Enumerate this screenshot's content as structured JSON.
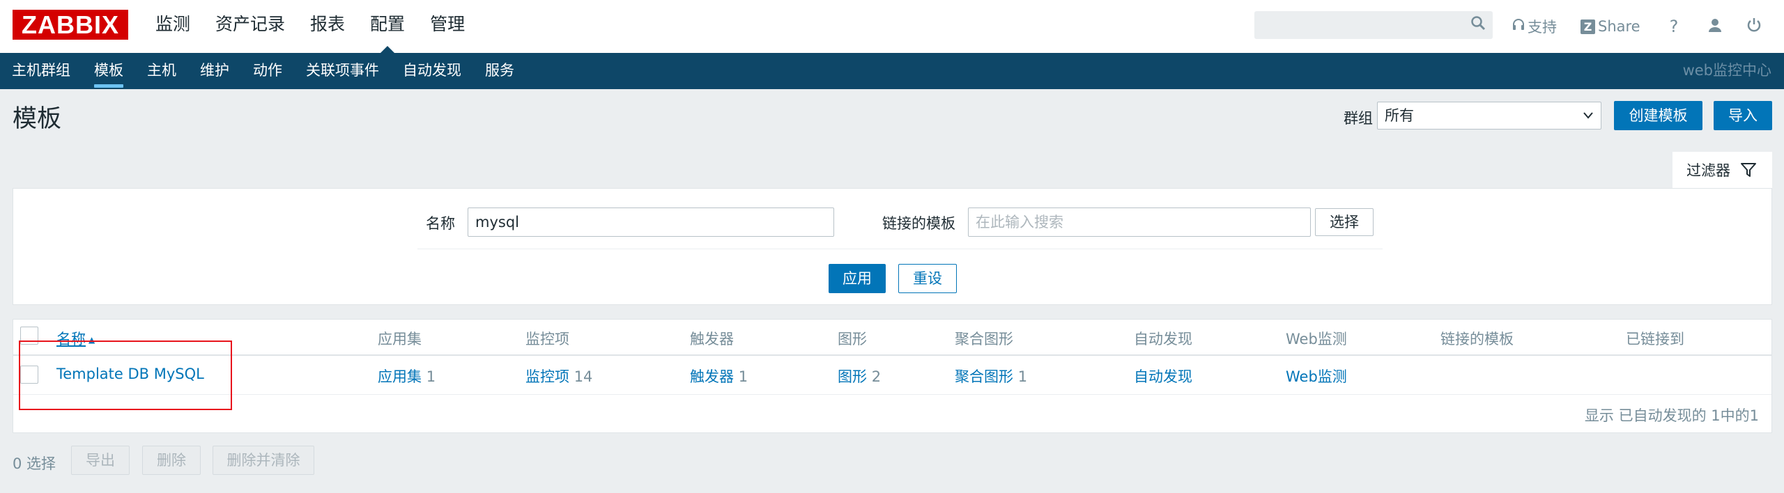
{
  "header": {
    "logo": "ZABBIX",
    "menu": [
      "监测",
      "资产记录",
      "报表",
      "配置",
      "管理"
    ],
    "active_menu": "配置",
    "links": {
      "support": "支持",
      "share": "Share",
      "help": "?"
    }
  },
  "submenu": {
    "items": [
      "主机群组",
      "模板",
      "主机",
      "维护",
      "动作",
      "关联项事件",
      "自动发现",
      "服务"
    ],
    "active": "模板",
    "right_text": "web监控中心"
  },
  "page": {
    "title": "模板",
    "group_label": "群组",
    "group_value": "所有",
    "create_button": "创建模板",
    "import_button": "导入"
  },
  "filter": {
    "tab_label": "过滤器",
    "name_label": "名称",
    "name_value": "mysql",
    "linked_label": "链接的模板",
    "linked_placeholder": "在此输入搜索",
    "select_button": "选择",
    "apply_button": "应用",
    "reset_button": "重设"
  },
  "table": {
    "columns": [
      "名称",
      "应用集",
      "监控项",
      "触发器",
      "图形",
      "聚合图形",
      "自动发现",
      "Web监测",
      "链接的模板",
      "已链接到"
    ],
    "rows": [
      {
        "name": "Template DB MySQL",
        "applications": {
          "label": "应用集",
          "count": "1"
        },
        "items": {
          "label": "监控项",
          "count": "14"
        },
        "triggers": {
          "label": "触发器",
          "count": "1"
        },
        "graphs": {
          "label": "图形",
          "count": "2"
        },
        "screens": {
          "label": "聚合图形",
          "count": "1"
        },
        "discovery": "自动发现",
        "web": "Web监测"
      }
    ],
    "footer": "显示 已自动发现的 1中的1"
  },
  "actions": {
    "selected": "0 选择",
    "export": "导出",
    "delete": "删除",
    "delete_clear": "删除并清除"
  },
  "colors": {
    "brand": "#d40000",
    "nav": "#0e4768",
    "accent": "#0275b8",
    "highlight": "#e8141c"
  }
}
